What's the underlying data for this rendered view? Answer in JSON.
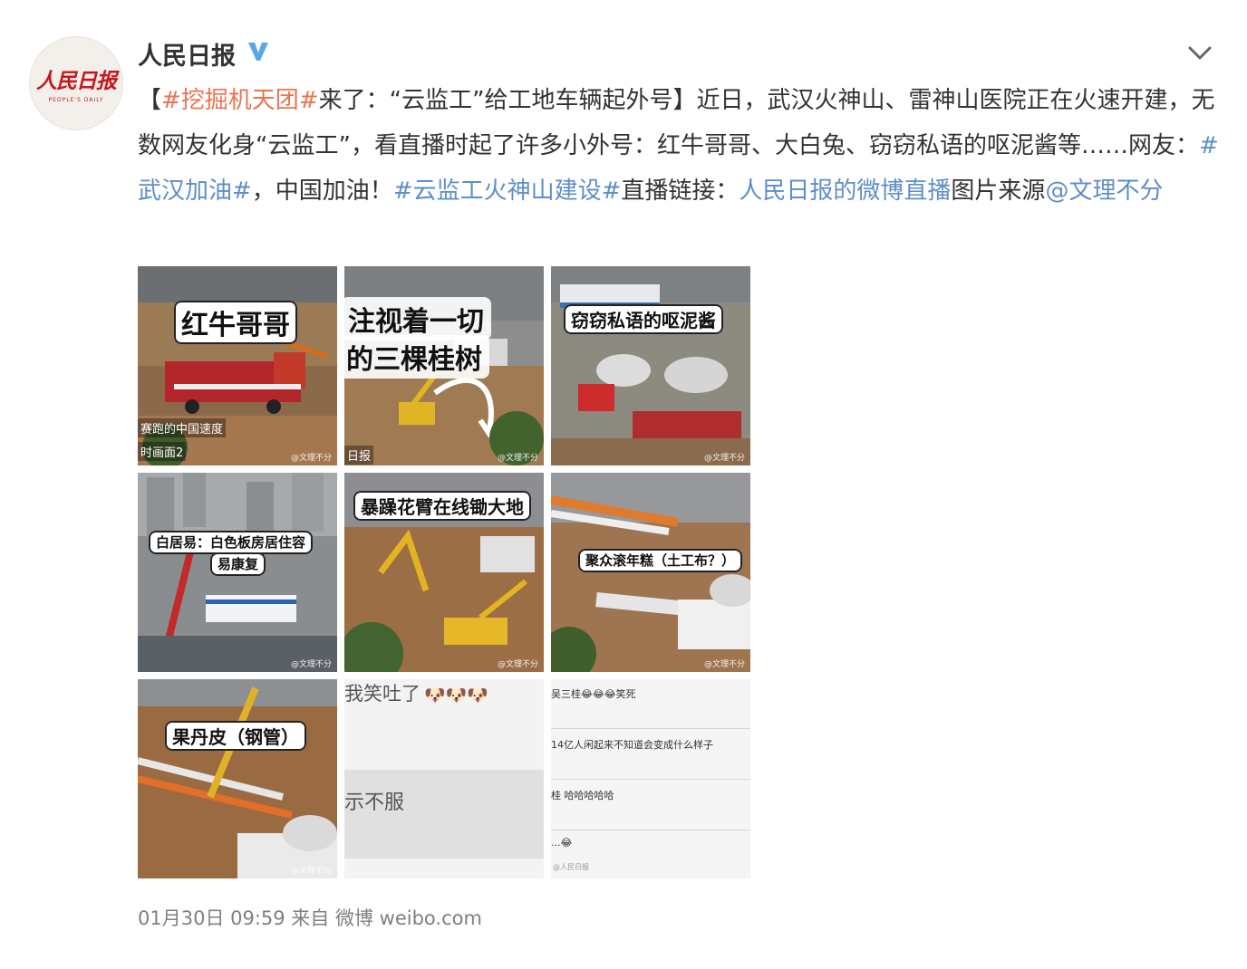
{
  "post": {
    "username": "人民日报",
    "avatar": {
      "brand": "人民日报",
      "brand_en": "PEOPLE'S DAILY"
    },
    "verified_icon": "verified-v-icon",
    "menu_icon": "chevron-down-icon",
    "text": {
      "bracket_open": "【",
      "tag1": "#挖掘机天团#",
      "seg1": "来了：“云监工”给工地车辆起外号】近日，武汉火神山、雷神山医院正在火速开建，无数网友化身“云监工”，看直播时起了许多小外号：红牛哥哥、大白兔、窃窃私语的呕泥酱等……网友：",
      "tag2": "#武汉加油#",
      "seg2": "，中国加油！",
      "tag3": "#云监工火神山建设#",
      "seg3": "直播链接：",
      "link": "人民日报的微博直播",
      "seg4": "图片来源",
      "mention": "@文理不分"
    },
    "images": [
      {
        "caption": "红牛哥哥",
        "sub1": "赛跑的中国速度",
        "sub2": "时画面2",
        "wm": "@文理不分"
      },
      {
        "caption1": "注视着一切",
        "caption2": "的三棵桂树",
        "sub": "日报",
        "wm": "@文理不分"
      },
      {
        "caption": "窃窃私语的呕泥酱",
        "wm": "@文理不分"
      },
      {
        "caption1": "白居易：白色板房居住容",
        "caption2": "易康复",
        "wm": "@文理不分"
      },
      {
        "caption": "暴躁花臂在线锄大地",
        "wm": "@文理不分"
      },
      {
        "caption": "聚众滚年糕（土工布？）",
        "wm": "@文理不分"
      },
      {
        "caption": "果丹皮（钢管）",
        "wm": "@文理不分"
      },
      {
        "line1": "我笑吐了",
        "line2": "示不服"
      },
      {
        "rows": [
          "吴三桂😂😂😂笑死",
          "14亿人闲起来不知道会变成什么样子",
          "桂 哈哈哈哈哈",
          "...😂"
        ],
        "wm": "@人民日报"
      }
    ],
    "footer": "01月30日 09:59  来自 微博 weibo.com"
  }
}
